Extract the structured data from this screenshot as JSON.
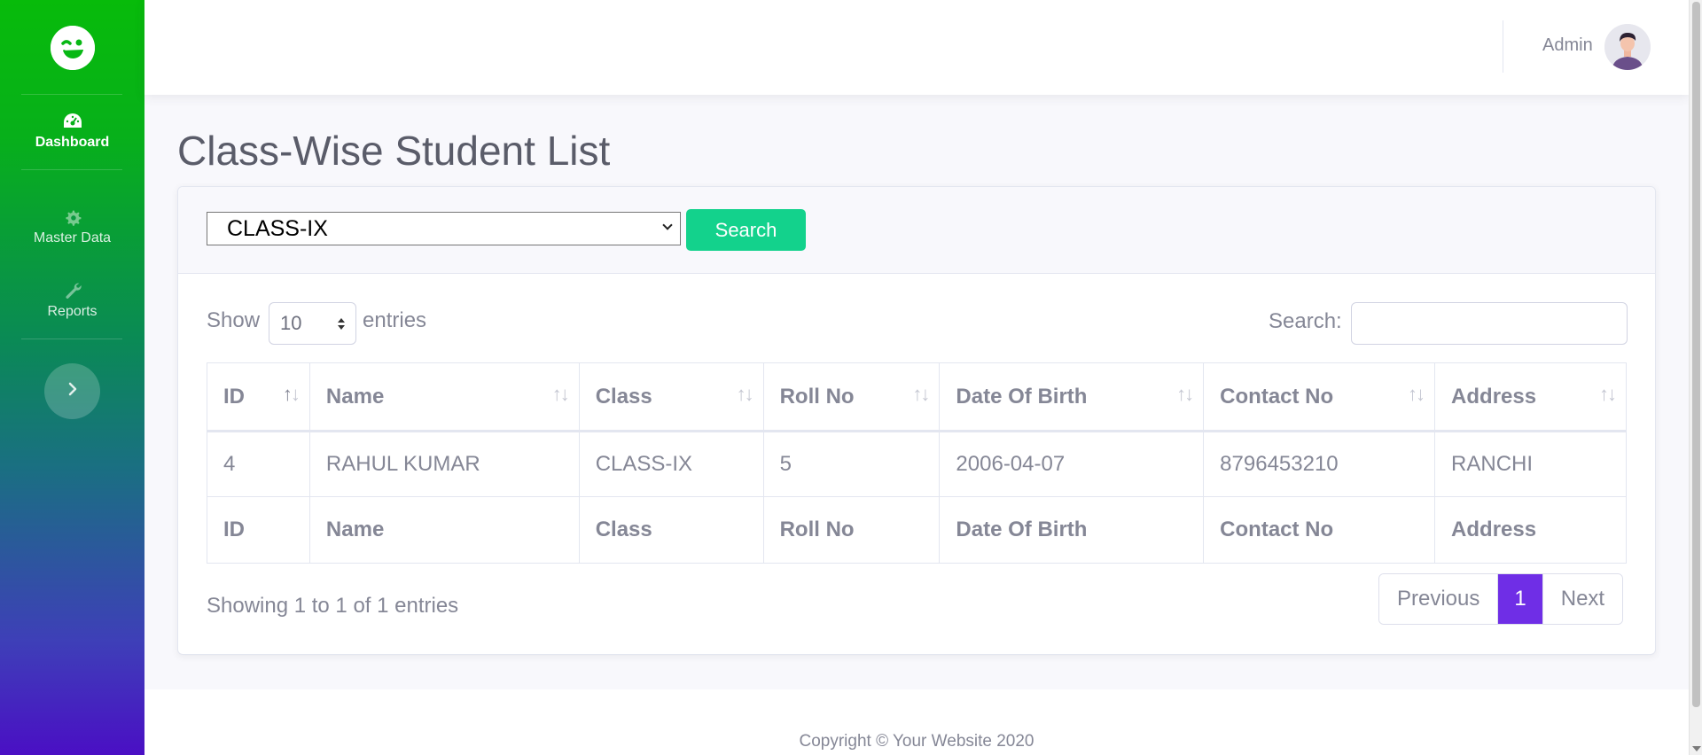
{
  "sidebar": {
    "brand_icon": "winking-smiley-icon",
    "items": [
      {
        "label": "Dashboard",
        "icon": "dashboard-gauge-icon",
        "active": true
      },
      {
        "label": "Master Data",
        "icon": "gear-icon",
        "active": false
      },
      {
        "label": "Reports",
        "icon": "wrench-icon",
        "active": false
      }
    ],
    "toggle_icon": "chevron-right-icon"
  },
  "topbar": {
    "user_name": "Admin",
    "avatar_icon": "user-avatar"
  },
  "page": {
    "title": "Class-Wise Student List"
  },
  "filter": {
    "selected_class": "CLASS-IX",
    "search_button": "Search"
  },
  "table_controls": {
    "show_label": "Show",
    "page_size": "10",
    "entries_label": "entries",
    "search_label": "Search:",
    "search_value": ""
  },
  "table": {
    "columns": [
      "ID",
      "Name",
      "Class",
      "Roll No",
      "Date Of Birth",
      "Contact No",
      "Address"
    ],
    "rows": [
      [
        "4",
        "RAHUL KUMAR",
        "CLASS-IX",
        "5",
        "2006-04-07",
        "8796453210",
        "RANCHI"
      ]
    ],
    "sorted_column": "ID"
  },
  "pagination": {
    "info": "Showing 1 to 1 of 1 entries",
    "previous": "Previous",
    "current": "1",
    "next": "Next"
  },
  "colors": {
    "accent_purple": "#6f2ee6",
    "search_button": "#13d28c",
    "sidebar_top": "#07bb0a",
    "sidebar_bottom": "#4a0fc4"
  },
  "footer": {
    "copyright": "Copyright © Your Website 2020"
  }
}
